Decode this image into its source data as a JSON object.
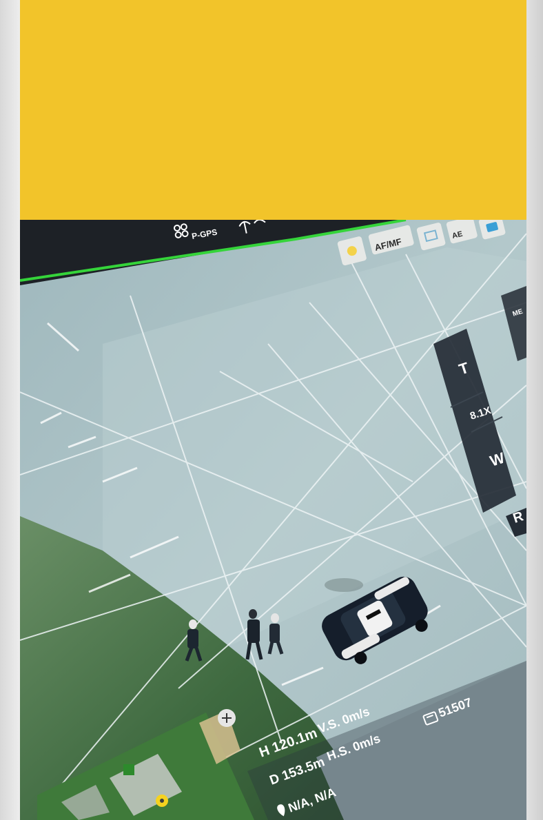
{
  "colors": {
    "banner": "#f2c42a",
    "screen_frame": "#1d2126",
    "pavement": "#a9c0c4",
    "grass": "#4f7a4e",
    "hud_green": "#35d43a"
  },
  "status_bar": {
    "gps_mode": "P-GPS"
  },
  "camera_controls": {
    "focus_mode": "AF/MF",
    "exposure_lock": "AE"
  },
  "zoom_panel": {
    "tele_label": "T",
    "zoom_level": "8.1X",
    "wide_label": "W",
    "reset_label": "R",
    "menu_label": "ME"
  },
  "telemetry": {
    "height": "H 120.1m",
    "vertical_speed": "V.S. 0m/s",
    "distance": "D 153.5m",
    "horizontal_speed": "H.S. 0m/s",
    "location": "N/A, N/A",
    "storage_remaining": "51507"
  },
  "icons": {
    "gps": "drone-icon",
    "signal": "antenna-icon",
    "sun": "sun-icon",
    "camera": "camera-icon",
    "storage": "sd-card-icon",
    "location": "location-pin-icon",
    "compass": "compass-icon"
  }
}
